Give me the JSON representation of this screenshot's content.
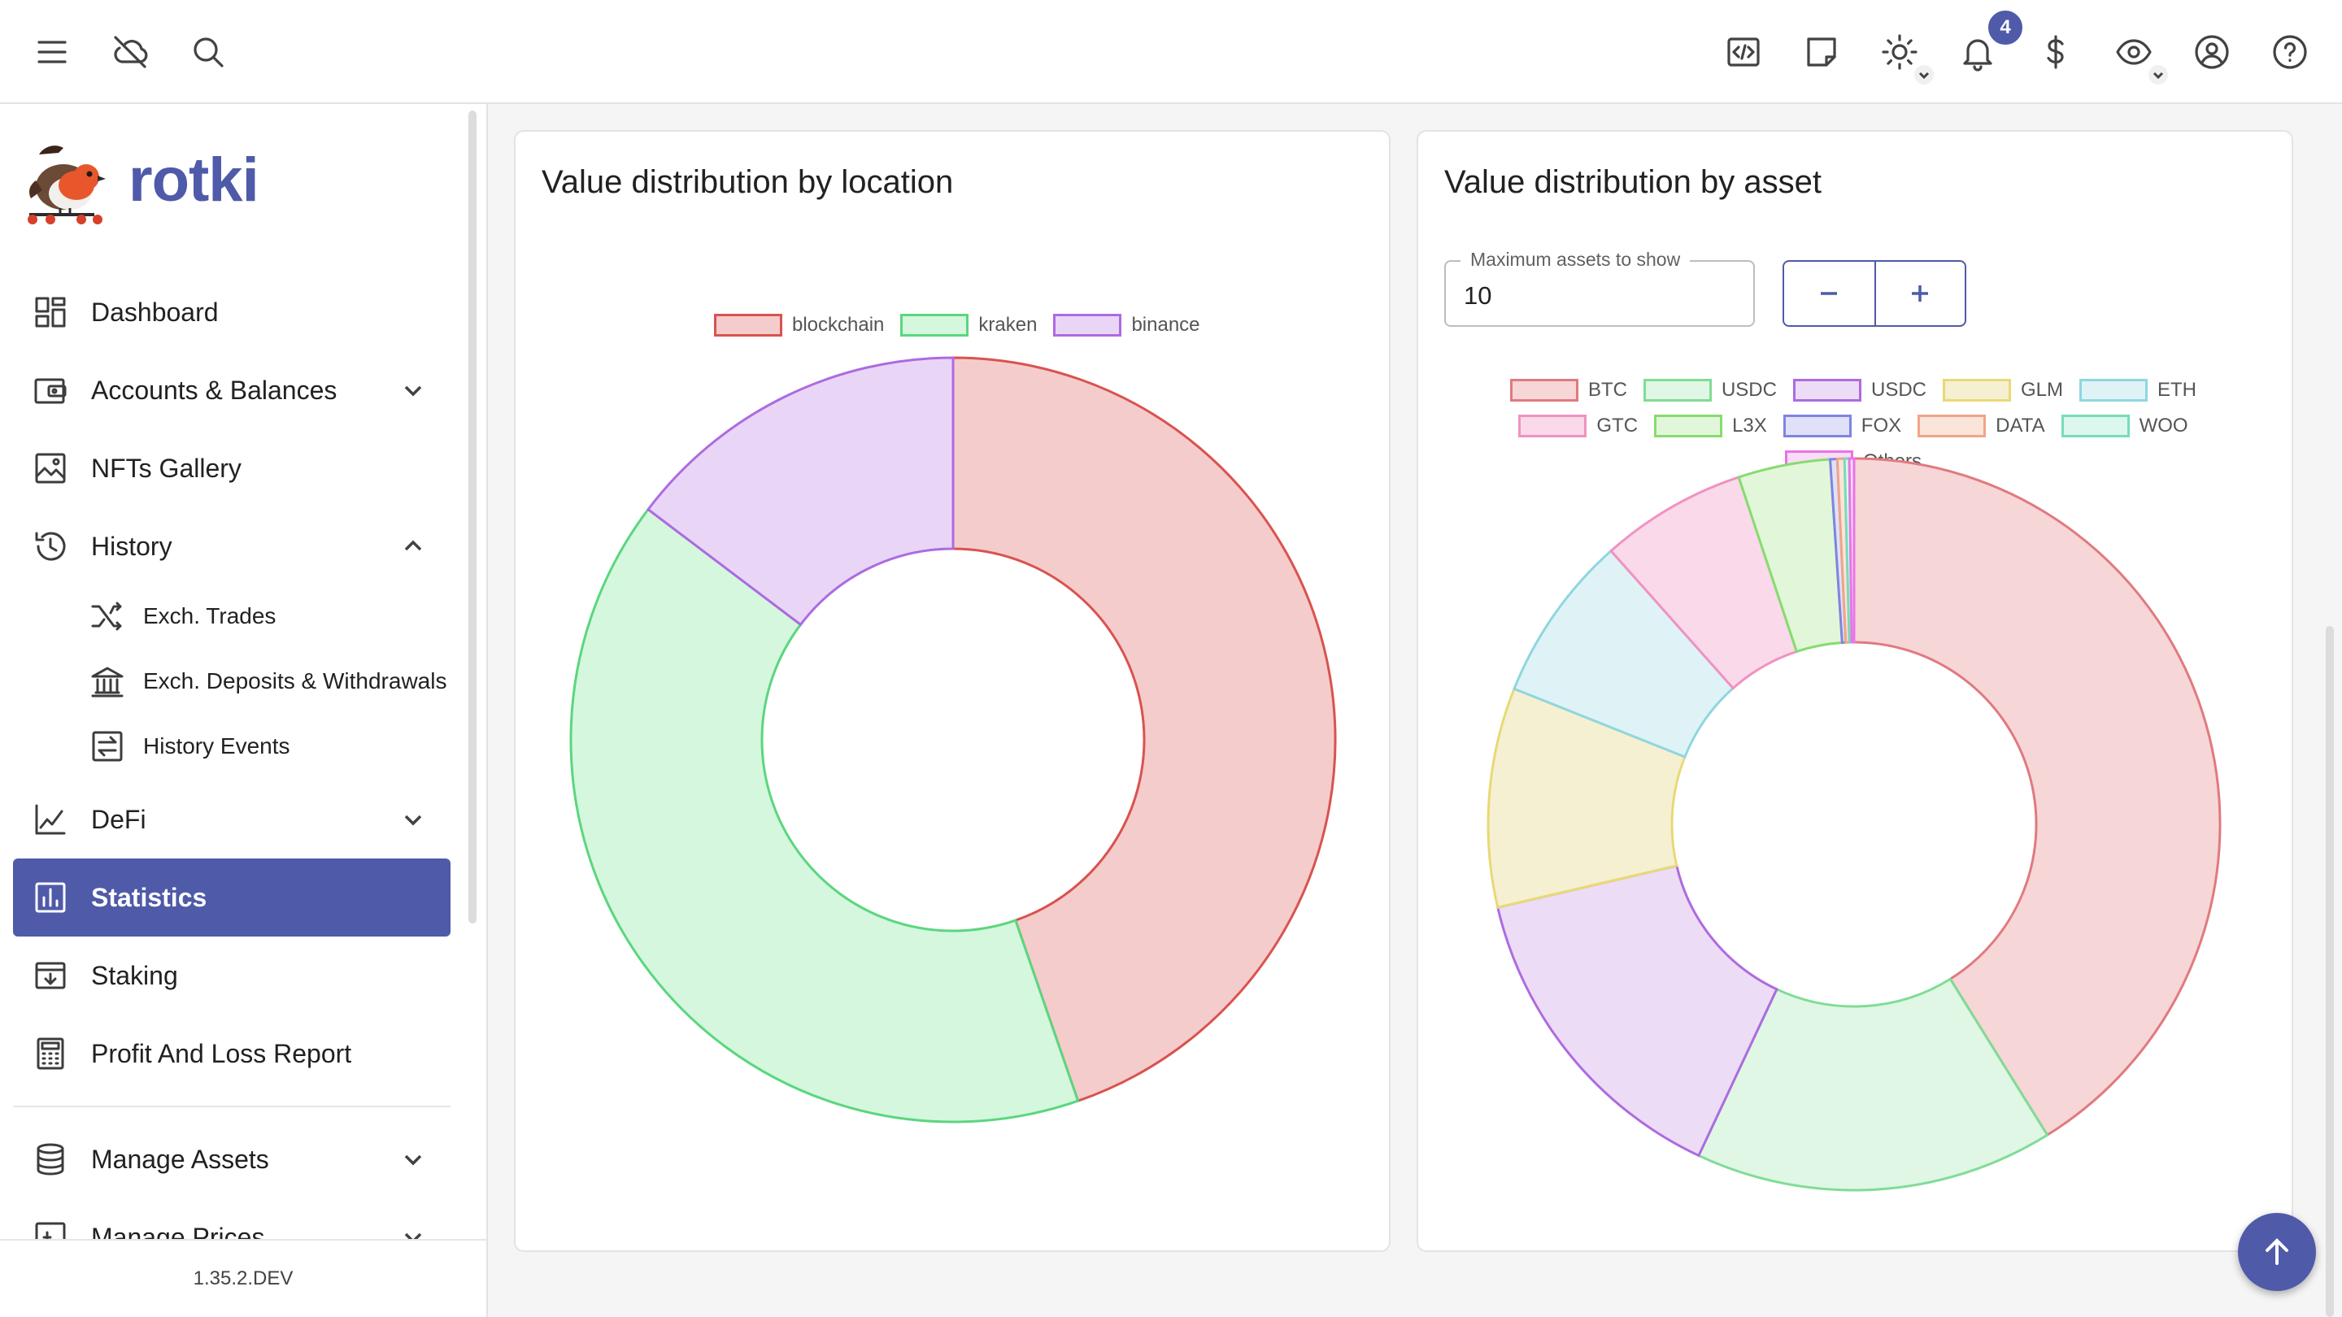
{
  "app": {
    "brand": "rotki",
    "version": "1.35.2.DEV"
  },
  "topbar": {
    "icons": [
      "menu-icon",
      "cloud-off-icon",
      "search-icon",
      "code-icon",
      "note-icon",
      "theme-icon",
      "bell-icon",
      "dollar-icon",
      "eye-icon",
      "account-icon",
      "help-icon"
    ],
    "notification_count": "4"
  },
  "sidebar": {
    "items": [
      {
        "label": "Dashboard"
      },
      {
        "label": "Accounts & Balances"
      },
      {
        "label": "NFTs Gallery"
      },
      {
        "label": "History"
      },
      {
        "label": "DeFi"
      },
      {
        "label": "Statistics"
      },
      {
        "label": "Staking"
      },
      {
        "label": "Profit And Loss Report"
      },
      {
        "label": "Manage Assets"
      },
      {
        "label": "Manage Prices"
      }
    ],
    "history_sub": [
      {
        "label": "Exch. Trades"
      },
      {
        "label": "Exch. Deposits & Withdrawals"
      },
      {
        "label": "History Events"
      }
    ]
  },
  "location_card": {
    "title": "Value distribution by location",
    "chart_data": {
      "type": "pie",
      "labels": [
        "blockchain",
        "kraken",
        "binance"
      ],
      "values": [
        44.7,
        40.6,
        14.7
      ],
      "colors": [
        "#d9534f",
        "#5bd67e",
        "#ad6be0"
      ],
      "fills": [
        "#f5cccc",
        "#d4f7de",
        "#e9d6f7"
      ],
      "legend_position": "top"
    }
  },
  "asset_card": {
    "title": "Value distribution by asset",
    "max_assets": {
      "label": "Maximum assets to show",
      "value": "10"
    },
    "chart_data": {
      "type": "pie",
      "labels": [
        "BTC",
        "USDC",
        "USDC",
        "GLM",
        "ETH",
        "GTC",
        "L3X",
        "FOX",
        "DATA",
        "WOO",
        "Others"
      ],
      "values": [
        39.5,
        15.2,
        13.8,
        9.3,
        7.1,
        6.2,
        3.9,
        0.3,
        0.3,
        0.2,
        0.2
      ],
      "colors": [
        "#e07a7f",
        "#7fdc95",
        "#ad6be0",
        "#e8d975",
        "#8fd6e0",
        "#f092c1",
        "#86dc6e",
        "#7f84e0",
        "#f0a586",
        "#79dcb8",
        "#e875e6"
      ],
      "fills": [
        "#f7d6d7",
        "#dff7e4",
        "#ecdcf5",
        "#f5f0d2",
        "#dff3f6",
        "#fad9ea",
        "#e2f7da",
        "#e0e1f8",
        "#fbe4da",
        "#dcf7ed",
        "#f9dcf8"
      ],
      "legend_position": "top"
    }
  }
}
